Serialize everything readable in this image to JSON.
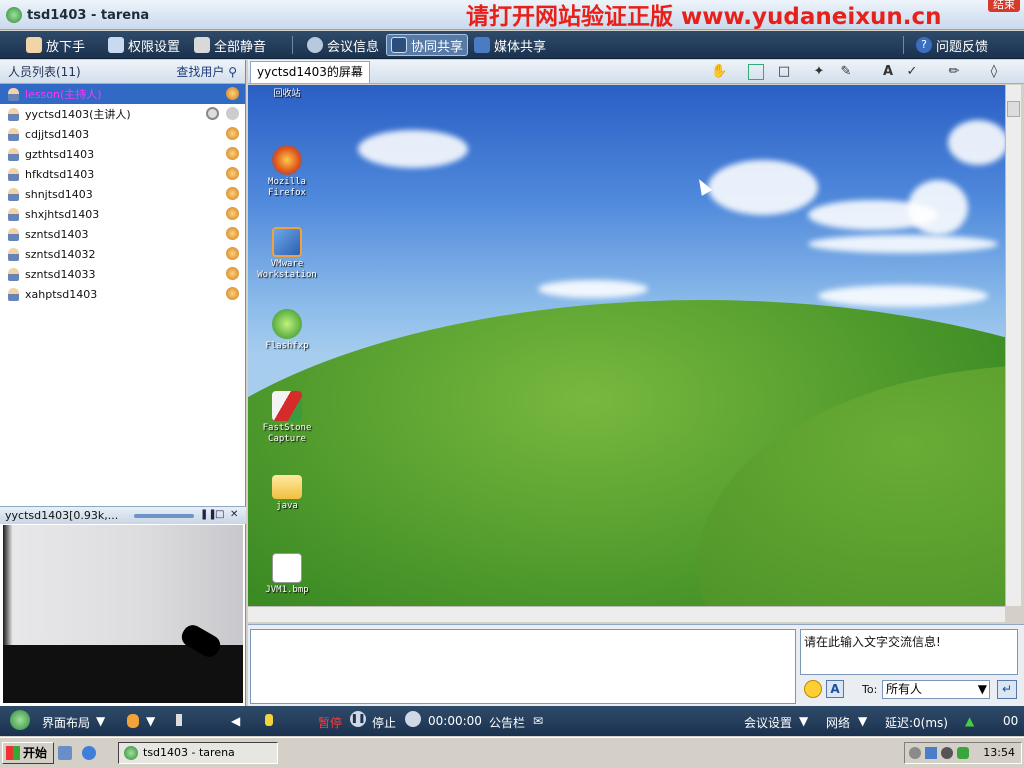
{
  "titlebar": {
    "title": "tsd1403 - tarena",
    "watermark": "请打开网站验证正版 www.yudaneixun.cn",
    "close": "结束"
  },
  "toolbar": {
    "raise_hand": "放下手",
    "permissions": "权限设置",
    "mute_all": "全部静音",
    "meeting_info": "会议信息",
    "co_share": "协同共享",
    "media_share": "媒体共享",
    "feedback": "问题反馈"
  },
  "members": {
    "header": "人员列表(11)",
    "find": "查找用户",
    "items": [
      "lesson(主持人)",
      "yyctsd1403(主讲人)",
      "cdjjtsd1403",
      "gzthtsd1403",
      "hfkdtsd1403",
      "shnjtsd1403",
      "shxjhtsd1403",
      "szntsd1403",
      "szntsd14032",
      "szntsd14033",
      "xahptsd1403"
    ]
  },
  "video": {
    "title": "yyctsd1403[0.93k,..."
  },
  "share": {
    "tab": "yyctsd1403的屏幕"
  },
  "desktop_icons": [
    "回收站",
    "Mozilla Firefox",
    "VMware Workstation",
    "Flashfxp",
    "FastStone Capture",
    "java",
    "JVM1.bmp"
  ],
  "chat": {
    "input": "请在此输入文字交流信息!",
    "to_label": "To:",
    "to_value": "所有人"
  },
  "statusbar": {
    "layout": "界面布局",
    "pause": "暂停",
    "stop": "停止",
    "time": "00:00:00",
    "board": "公告栏",
    "settings": "会议设置",
    "network": "网络",
    "latency": "延迟:0(ms)",
    "rate": "00"
  },
  "taskbar": {
    "start": "开始",
    "task": "tsd1403 - tarena",
    "clock": "13:54"
  },
  "colors": {
    "accent": "#1b324e",
    "host": "#ff33ff",
    "watermark": "#e8201a"
  }
}
